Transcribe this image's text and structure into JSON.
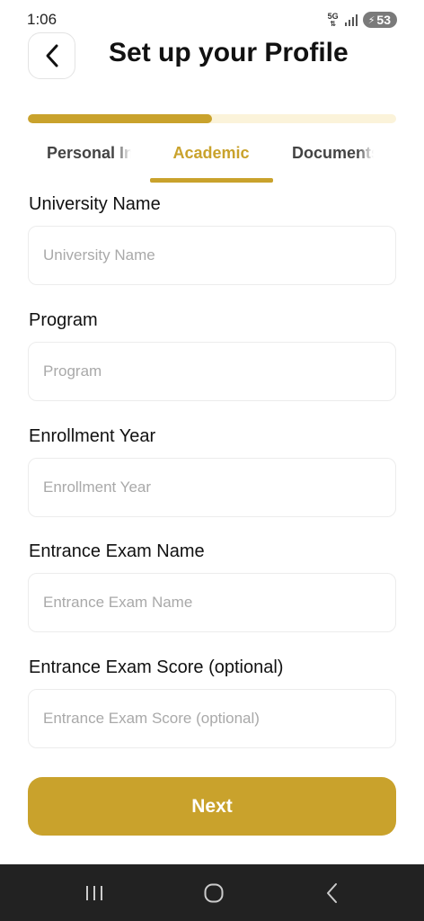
{
  "status_bar": {
    "time": "1:06",
    "network": "5G",
    "battery": "53"
  },
  "header": {
    "title": "Set up your Profile",
    "back_icon": "chevron-left-icon"
  },
  "progress": {
    "fraction": 0.5,
    "fill_color": "#c9a22c",
    "track_color": "#fbf3da"
  },
  "tabs": [
    {
      "label": "Personal Information",
      "active": false
    },
    {
      "label": "Academic",
      "active": true
    },
    {
      "label": "Documents",
      "active": false
    }
  ],
  "form": {
    "fields": [
      {
        "label": "University Name",
        "placeholder": "University Name",
        "value": ""
      },
      {
        "label": "Program",
        "placeholder": "Program",
        "value": ""
      },
      {
        "label": "Enrollment Year",
        "placeholder": "Enrollment Year",
        "value": ""
      },
      {
        "label": "Entrance Exam Name",
        "placeholder": "Entrance Exam Name",
        "value": ""
      },
      {
        "label": "Entrance Exam Score (optional)",
        "placeholder": "Entrance Exam Score (optional)",
        "value": ""
      }
    ],
    "next_label": "Next"
  },
  "colors": {
    "accent": "#c9a22c",
    "text": "#111111",
    "placeholder": "#a9a9a9"
  },
  "nav_bar": {
    "icons": [
      "recent-apps-icon",
      "home-icon",
      "back-icon"
    ]
  }
}
